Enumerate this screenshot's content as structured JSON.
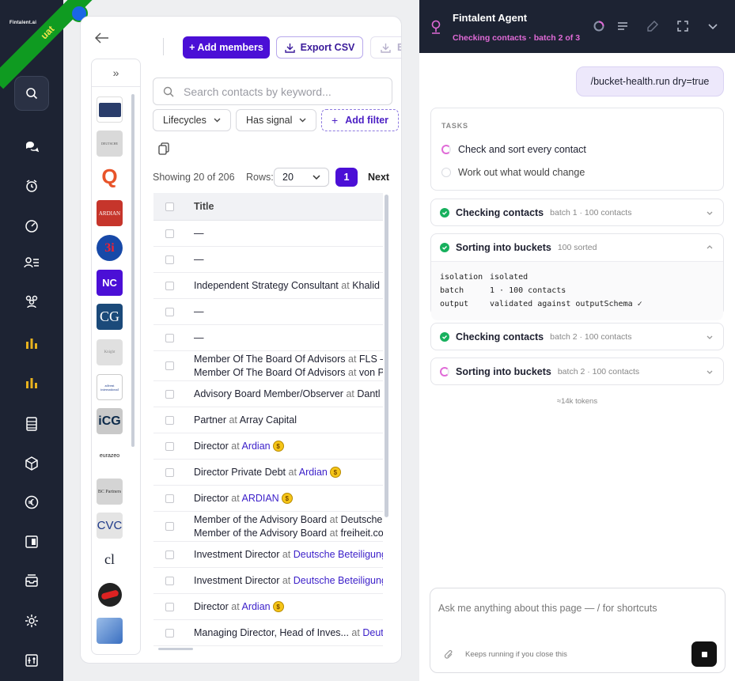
{
  "nav": {
    "logo": "Fintalent.ai",
    "env_badge": "uat",
    "items": [
      "search-icon",
      "chat-icon",
      "bell-icon",
      "dashboard-icon",
      "contacts-icon",
      "users-icon",
      "chart-icon",
      "chart-icon",
      "table-icon",
      "cube-icon",
      "euro-icon",
      "layout-icon",
      "inbox-icon",
      "settings-icon",
      "sliders-icon"
    ]
  },
  "toolbar": {
    "add_members": "+ Add members",
    "export_csv": "Export CSV",
    "third_button": "E"
  },
  "logos": [
    "Deutsche Beteiligungs AG",
    "DEUTSCHE",
    "Q",
    "ARDIAN",
    "3i",
    "NC",
    "CG",
    "Knight",
    "advent international",
    "iCG",
    "eurazeo",
    "BC Partners",
    "CVC",
    "cl",
    "swirl",
    "blue"
  ],
  "search": {
    "placeholder": "Search contacts by keyword..."
  },
  "filters": {
    "lifecycles": "Lifecycles",
    "has_signal": "Has signal",
    "add_filter": "Add filter"
  },
  "pagination": {
    "showing": "Showing 20 of 206",
    "rows_label": "Rows:",
    "rows_value": "20",
    "page": "1",
    "next": "Next"
  },
  "table": {
    "header": "Title",
    "rows": [
      {
        "lines": [
          {
            "title": "—",
            "at": "",
            "org": ""
          }
        ]
      },
      {
        "lines": [
          {
            "title": "—",
            "at": "",
            "org": ""
          }
        ]
      },
      {
        "lines": [
          {
            "title": "Independent Strategy Consultant",
            "at": "at",
            "org": "Khalid"
          }
        ]
      },
      {
        "lines": [
          {
            "title": "—",
            "at": "",
            "org": ""
          }
        ]
      },
      {
        "lines": [
          {
            "title": "—",
            "at": "",
            "org": ""
          }
        ]
      },
      {
        "lines": [
          {
            "title": "Member Of The Board Of Advisors",
            "at": "at",
            "org": "FLS –"
          },
          {
            "title": "Member Of The Board Of Advisors",
            "at": "at",
            "org": "von P"
          }
        ]
      },
      {
        "lines": [
          {
            "title": "Advisory Board Member/Observer",
            "at": "at",
            "org": "Dantl"
          }
        ]
      },
      {
        "lines": [
          {
            "title": "Partner",
            "at": "at",
            "org": "Array Capital"
          }
        ]
      },
      {
        "lines": [
          {
            "title": "Director",
            "at": "at",
            "org": "Ardian",
            "link": true,
            "coin": "$"
          }
        ]
      },
      {
        "lines": [
          {
            "title": "Director Private Debt",
            "at": "at",
            "org": "Ardian",
            "link": true,
            "coin": "$"
          }
        ]
      },
      {
        "lines": [
          {
            "title": "Director",
            "at": "at",
            "org": "ARDIAN",
            "link": true,
            "coin": "$"
          }
        ]
      },
      {
        "lines": [
          {
            "title": "Member of the Advisory Board",
            "at": "at",
            "org": "Deutsche"
          },
          {
            "title": "Member of the Advisory Board",
            "at": "at",
            "org": "freiheit.co"
          }
        ]
      },
      {
        "lines": [
          {
            "title": "Investment Director",
            "at": "at",
            "org": "Deutsche Beteiligung",
            "link": true
          }
        ]
      },
      {
        "lines": [
          {
            "title": "Investment Director",
            "at": "at",
            "org": "Deutsche Beteiligung",
            "link": true
          }
        ]
      },
      {
        "lines": [
          {
            "title": "Director",
            "at": "at",
            "org": "Ardian",
            "link": true,
            "coin": "$"
          }
        ]
      },
      {
        "lines": [
          {
            "title": "Managing Director, Head of Inves...",
            "at": "at",
            "org": "Deut",
            "link": true
          }
        ]
      }
    ]
  },
  "agent": {
    "title": "Fintalent Agent",
    "status": "Checking contacts · batch 2 of 3",
    "user_message": "/bucket-health.run dry=true",
    "tasks_heading": "TASKS",
    "tasks": [
      "Check and sort every contact",
      "Work out what would change"
    ],
    "steps": [
      {
        "label": "Checking contacts",
        "meta": "batch 1 · 100 contacts",
        "done": true
      },
      {
        "label": "Sorting into buckets",
        "meta": "100 sorted",
        "done": true,
        "expanded": true,
        "details": [
          [
            "isolation",
            "isolated"
          ],
          [
            "batch",
            "1 · 100 contacts"
          ],
          [
            "output",
            "validated against outputSchema ✓"
          ]
        ]
      },
      {
        "label": "Checking contacts",
        "meta": "batch 2 · 100 contacts",
        "done": true
      },
      {
        "label": "Sorting into buckets",
        "meta": "batch 2 · 100 contacts",
        "done": false
      }
    ],
    "tokens": "≈14k tokens",
    "composer_placeholder": "Ask me anything about this page — / for shortcuts",
    "keep_running": "Keeps running if you close this"
  },
  "colors": {
    "accent": "#4b0fd6",
    "nav_bg": "#1d2333",
    "status_pink": "#e06ad7",
    "success": "#17b05d"
  }
}
